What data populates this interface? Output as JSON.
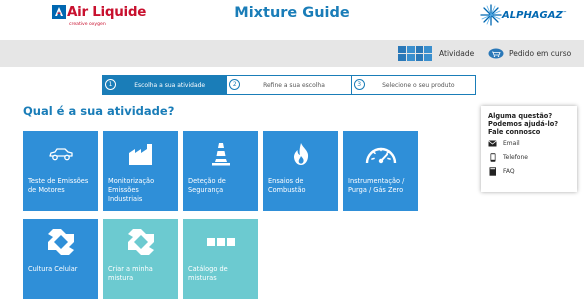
{
  "header": {
    "brand_left": "Air Liquide",
    "brand_left_tagline": "creative oxygen",
    "title": "Mixture Guide",
    "brand_right": "ALPHAGAZ",
    "brand_right_tm": "™"
  },
  "topbar": {
    "activity_label": "Atividade",
    "order_label": "Pedido em curso"
  },
  "steps": [
    {
      "num": "1",
      "label": "Escolha a sua atividade",
      "active": true
    },
    {
      "num": "2",
      "label": "Refine a sua escolha",
      "active": false
    },
    {
      "num": "3",
      "label": "Selecione o seu produto",
      "active": false
    }
  ],
  "section_title": "Qual é a sua atividade?",
  "tiles": [
    {
      "label": "Teste de Emissões de Motores",
      "icon": "car-icon",
      "style": "blue"
    },
    {
      "label": "Monitorização Emissões Industriais",
      "icon": "factory-icon",
      "style": "blue"
    },
    {
      "label": "Deteção de Segurança",
      "icon": "traffic-cone-icon",
      "style": "blue"
    },
    {
      "label": "Ensaios de Combustão",
      "icon": "flame-icon",
      "style": "blue"
    },
    {
      "label": "Instrumentação / Purga / Gás Zero",
      "icon": "gauge-icon",
      "style": "blue"
    },
    {
      "label": "Cultura Celular",
      "icon": "cell-culture-icon",
      "style": "blue"
    },
    {
      "label": "Criar a minha mistura",
      "icon": "custom-mixture-icon",
      "style": "teal"
    },
    {
      "label": "Catálogo de misturas",
      "icon": "catalog-icon",
      "style": "teal"
    }
  ],
  "help": {
    "title": "Alguma questão? Podemos ajudá-lo? Fale connosco",
    "items": [
      {
        "label": "Email",
        "icon": "envelope-icon"
      },
      {
        "label": "Telefone",
        "icon": "phone-icon"
      },
      {
        "label": "FAQ",
        "icon": "faq-icon"
      }
    ]
  },
  "colors": {
    "primary_blue": "#1a7db8",
    "tile_blue": "#2f8fd8",
    "tile_teal": "#6ccad0",
    "brand_red": "#c8102e",
    "topbar_gray": "#e6e6e6"
  }
}
